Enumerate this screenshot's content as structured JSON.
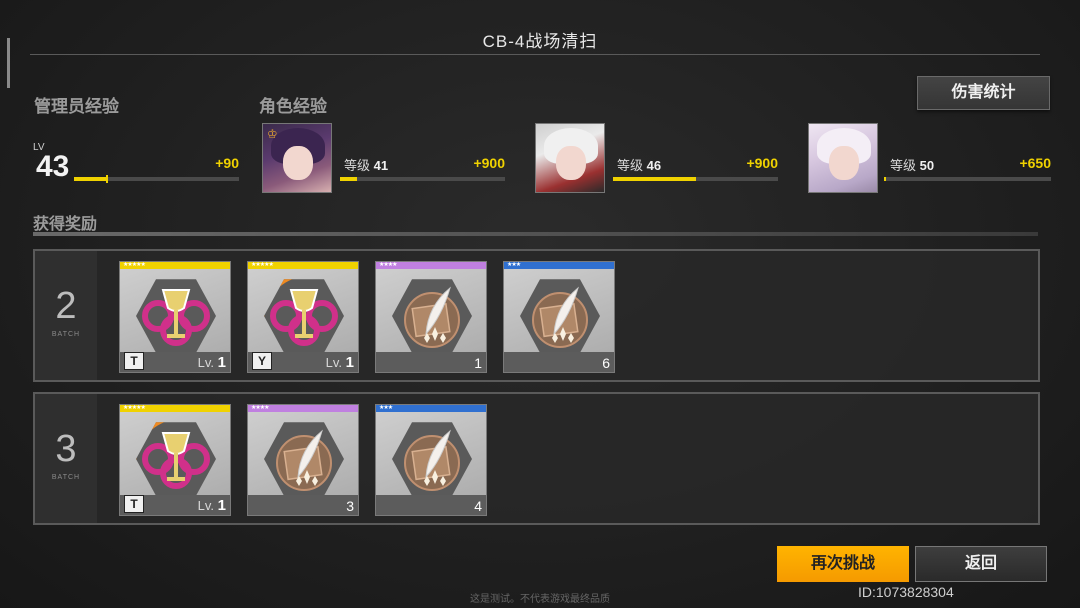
{
  "header": {
    "title": "CB-4战场清扫"
  },
  "damage_stats_label": "伤害统计",
  "admin": {
    "section_label": "管理员经验",
    "lv_label": "LV",
    "level": "43",
    "exp_gain": "+90",
    "progress": 0.2
  },
  "characters": {
    "section_label": "角色经验",
    "list": [
      {
        "level_label": "等级",
        "level": "41",
        "exp_gain": "+900",
        "progress": 0.1
      },
      {
        "level_label": "等级",
        "level": "46",
        "exp_gain": "+900",
        "progress": 0.5
      },
      {
        "level_label": "等级",
        "level": "50",
        "exp_gain": "+650",
        "progress": 0.01
      }
    ]
  },
  "rewards": {
    "section_label": "获得奖励",
    "batch_word": "BATCH",
    "batches": [
      {
        "number": "2",
        "items": [
          {
            "rarity_color": "#f0d200",
            "stars": "★★★★★",
            "type": "chalice",
            "lv_prefix": "Lv.",
            "level": "1",
            "badge": "T",
            "arc": false
          },
          {
            "rarity_color": "#f0d200",
            "stars": "★★★★★",
            "type": "chalice",
            "lv_prefix": "Lv.",
            "level": "1",
            "badge": "Y",
            "arc": true
          },
          {
            "rarity_color": "#c080e0",
            "stars": "★★★★",
            "type": "feather",
            "count": "1"
          },
          {
            "rarity_color": "#3070d0",
            "stars": "★★★",
            "type": "feather",
            "count": "6"
          }
        ]
      },
      {
        "number": "3",
        "items": [
          {
            "rarity_color": "#f0d200",
            "stars": "★★★★★",
            "type": "chalice",
            "lv_prefix": "Lv.",
            "level": "1",
            "badge": "T",
            "arc": true
          },
          {
            "rarity_color": "#c080e0",
            "stars": "★★★★",
            "type": "feather",
            "count": "3"
          },
          {
            "rarity_color": "#3070d0",
            "stars": "★★★",
            "type": "feather",
            "count": "4"
          }
        ]
      }
    ]
  },
  "buttons": {
    "retry": "再次挑战",
    "back": "返回"
  },
  "user_id": "ID:1073828304",
  "disclaimer": "这是测试。不代表游戏最终品质"
}
